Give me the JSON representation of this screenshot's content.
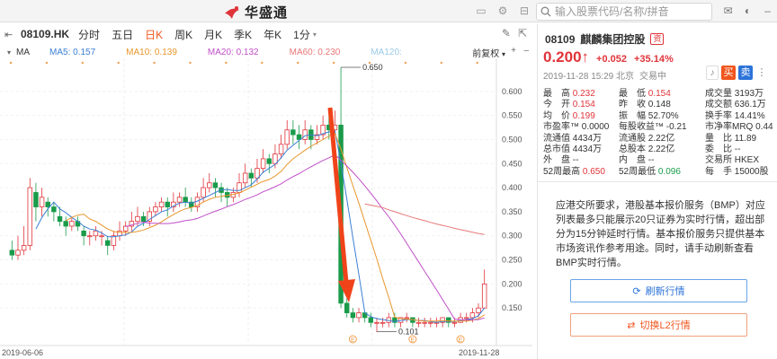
{
  "topbar": {
    "logo_text": "华盛通",
    "search_placeholder": "输入股票代码/名称/拼音",
    "icons": [
      "monitor-icon",
      "settings-icon",
      "minimize-icon",
      "maximize-icon",
      "mail-icon",
      "theme-icon",
      "window-minimize-icon",
      "close-icon"
    ]
  },
  "toolbar": {
    "stock_code": "08109.HK",
    "periods": [
      {
        "label": "分时",
        "active": false
      },
      {
        "label": "五日",
        "active": false
      },
      {
        "label": "日K",
        "active": true
      },
      {
        "label": "周K",
        "active": false
      },
      {
        "label": "月K",
        "active": false
      },
      {
        "label": "季K",
        "active": false
      },
      {
        "label": "年K",
        "active": false
      }
    ],
    "more_period": "1分",
    "more_chevron": "▾"
  },
  "ma_row": {
    "indicator": "MA",
    "items": [
      {
        "label": "MA5: 0.157",
        "color": "#3a7fd5"
      },
      {
        "label": "MA10: 0.139",
        "color": "#e8962c"
      },
      {
        "label": "MA20: 0.132",
        "color": "#c04fc8"
      },
      {
        "label": "MA60: 0.230",
        "color": "#e87878"
      },
      {
        "label": "MA120:",
        "color": "#9bc9e8"
      }
    ],
    "adjust": "前复权",
    "adjust_chevron": "▾"
  },
  "quote": {
    "code": "08109",
    "name": "麒麟集团控股",
    "badge": "资",
    "price": "0.200",
    "arrow": "↑",
    "change": "+0.052",
    "change_pct": "+35.14%",
    "time": "2019-11-28 15:29 北京",
    "status": "交易中",
    "buy": "买",
    "sell": "卖",
    "stats": [
      {
        "label": "最　高",
        "value": "0.232",
        "color": "red"
      },
      {
        "label": "最　低",
        "value": "0.154",
        "color": "red"
      },
      {
        "label": "成交量",
        "value": "3193万",
        "color": ""
      },
      {
        "label": "今　开",
        "value": "0.154",
        "color": "red"
      },
      {
        "label": "昨　收",
        "value": "0.148",
        "color": ""
      },
      {
        "label": "成交额",
        "value": "636.1万",
        "color": ""
      },
      {
        "label": "均　价",
        "value": "0.199",
        "color": "red"
      },
      {
        "label": "振　幅",
        "value": "52.70%",
        "color": ""
      },
      {
        "label": "换手率",
        "value": "14.41%",
        "color": ""
      },
      {
        "label": "市盈率™",
        "value": "0.0000",
        "color": ""
      },
      {
        "label": "每股收益™",
        "value": "-0.21",
        "color": ""
      },
      {
        "label": "市净率MRQ",
        "value": "0.44",
        "color": ""
      },
      {
        "label": "流通值",
        "value": "4434万",
        "color": ""
      },
      {
        "label": "流通股",
        "value": "2.22亿",
        "color": ""
      },
      {
        "label": "量　比",
        "value": "11.89",
        "color": ""
      },
      {
        "label": "总市值",
        "value": "4434万",
        "color": ""
      },
      {
        "label": "总股本",
        "value": "2.22亿",
        "color": ""
      },
      {
        "label": "委　比",
        "value": "--",
        "color": ""
      },
      {
        "label": "外　盘",
        "value": "--",
        "color": ""
      },
      {
        "label": "内　盘",
        "value": "--",
        "color": ""
      },
      {
        "label": "交易所",
        "value": "HKEX",
        "color": ""
      },
      {
        "label": "52周最高",
        "value": "0.650",
        "color": "red"
      },
      {
        "label": "52周最低",
        "value": "0.096",
        "color": "green"
      },
      {
        "label": "每　手",
        "value": "15000股",
        "color": ""
      }
    ]
  },
  "notice": {
    "text": "应港交所要求，港股基本报价服务（BMP）对应列表最多只能展示20只证券为实时行情，超出部分为15分钟延时行情。基本报价服务只提供基本市场资讯作参考用途。同时，请手动刷新查看BMP实时行情。",
    "refresh_button": "刷新行情",
    "l2_button": "切换L2行情"
  },
  "chart_data": {
    "type": "candlestick",
    "y_ticks": [
      "0.600",
      "0.550",
      "0.500",
      "0.450",
      "0.400",
      "0.350",
      "0.300",
      "0.250",
      "0.200",
      "0.150"
    ],
    "ylim": [
      0.1,
      0.65
    ],
    "x_start_label": "2019-06-06",
    "x_end_label": "2019-11-28",
    "annotations": {
      "high": "0.650",
      "low": "0.101"
    },
    "event_markers": "E",
    "candles": [
      [
        0.27,
        0.26,
        0.29,
        0.25
      ],
      [
        0.26,
        0.27,
        0.3,
        0.25
      ],
      [
        0.27,
        0.28,
        0.32,
        0.26
      ],
      [
        0.28,
        0.4,
        0.42,
        0.27
      ],
      [
        0.39,
        0.36,
        0.41,
        0.33
      ],
      [
        0.36,
        0.38,
        0.4,
        0.34
      ],
      [
        0.37,
        0.36,
        0.38,
        0.34
      ],
      [
        0.36,
        0.35,
        0.37,
        0.33
      ],
      [
        0.34,
        0.33,
        0.36,
        0.32
      ],
      [
        0.33,
        0.32,
        0.34,
        0.3
      ],
      [
        0.32,
        0.33,
        0.34,
        0.31
      ],
      [
        0.33,
        0.32,
        0.34,
        0.31
      ],
      [
        0.31,
        0.3,
        0.32,
        0.28
      ],
      [
        0.3,
        0.3,
        0.31,
        0.28
      ],
      [
        0.3,
        0.31,
        0.32,
        0.29
      ],
      [
        0.3,
        0.3,
        0.31,
        0.28
      ],
      [
        0.29,
        0.28,
        0.3,
        0.26
      ],
      [
        0.28,
        0.3,
        0.31,
        0.27
      ],
      [
        0.3,
        0.31,
        0.33,
        0.29
      ],
      [
        0.31,
        0.32,
        0.33,
        0.3
      ],
      [
        0.32,
        0.33,
        0.35,
        0.31
      ],
      [
        0.33,
        0.34,
        0.36,
        0.32
      ],
      [
        0.34,
        0.33,
        0.35,
        0.32
      ],
      [
        0.33,
        0.35,
        0.36,
        0.32
      ],
      [
        0.35,
        0.36,
        0.37,
        0.34
      ],
      [
        0.36,
        0.37,
        0.38,
        0.35
      ],
      [
        0.37,
        0.36,
        0.38,
        0.34
      ],
      [
        0.36,
        0.37,
        0.39,
        0.35
      ],
      [
        0.37,
        0.38,
        0.39,
        0.36
      ],
      [
        0.38,
        0.37,
        0.4,
        0.36
      ],
      [
        0.37,
        0.36,
        0.38,
        0.35
      ],
      [
        0.36,
        0.38,
        0.39,
        0.35
      ],
      [
        0.38,
        0.4,
        0.42,
        0.37
      ],
      [
        0.4,
        0.41,
        0.43,
        0.39
      ],
      [
        0.41,
        0.4,
        0.42,
        0.38
      ],
      [
        0.4,
        0.39,
        0.41,
        0.37
      ],
      [
        0.39,
        0.38,
        0.4,
        0.36
      ],
      [
        0.38,
        0.39,
        0.4,
        0.37
      ],
      [
        0.39,
        0.41,
        0.43,
        0.38
      ],
      [
        0.41,
        0.43,
        0.45,
        0.4
      ],
      [
        0.43,
        0.42,
        0.44,
        0.4
      ],
      [
        0.42,
        0.44,
        0.46,
        0.41
      ],
      [
        0.44,
        0.46,
        0.48,
        0.43
      ],
      [
        0.46,
        0.45,
        0.47,
        0.43
      ],
      [
        0.45,
        0.47,
        0.49,
        0.44
      ],
      [
        0.47,
        0.49,
        0.51,
        0.46
      ],
      [
        0.49,
        0.52,
        0.54,
        0.48
      ],
      [
        0.52,
        0.51,
        0.54,
        0.49
      ],
      [
        0.51,
        0.5,
        0.53,
        0.48
      ],
      [
        0.5,
        0.52,
        0.54,
        0.49
      ],
      [
        0.52,
        0.5,
        0.53,
        0.48
      ],
      [
        0.5,
        0.51,
        0.53,
        0.49
      ],
      [
        0.51,
        0.53,
        0.55,
        0.5
      ],
      [
        0.53,
        0.52,
        0.55,
        0.5
      ],
      [
        0.52,
        0.53,
        0.56,
        0.51
      ],
      [
        0.53,
        0.16,
        0.65,
        0.15
      ],
      [
        0.16,
        0.14,
        0.17,
        0.13
      ],
      [
        0.14,
        0.13,
        0.15,
        0.12
      ],
      [
        0.13,
        0.14,
        0.15,
        0.12
      ],
      [
        0.14,
        0.13,
        0.14,
        0.12
      ],
      [
        0.13,
        0.12,
        0.14,
        0.11
      ],
      [
        0.12,
        0.12,
        0.13,
        0.1
      ],
      [
        0.12,
        0.12,
        0.13,
        0.11
      ],
      [
        0.12,
        0.13,
        0.14,
        0.11
      ],
      [
        0.13,
        0.12,
        0.14,
        0.11
      ],
      [
        0.12,
        0.13,
        0.13,
        0.11
      ],
      [
        0.13,
        0.13,
        0.14,
        0.12
      ],
      [
        0.13,
        0.12,
        0.13,
        0.11
      ],
      [
        0.12,
        0.12,
        0.13,
        0.11
      ],
      [
        0.12,
        0.12,
        0.13,
        0.11
      ],
      [
        0.12,
        0.12,
        0.13,
        0.11
      ],
      [
        0.12,
        0.12,
        0.13,
        0.11
      ],
      [
        0.12,
        0.13,
        0.13,
        0.11
      ],
      [
        0.13,
        0.12,
        0.13,
        0.11
      ],
      [
        0.12,
        0.12,
        0.13,
        0.11
      ],
      [
        0.12,
        0.13,
        0.14,
        0.12
      ],
      [
        0.13,
        0.13,
        0.14,
        0.12
      ],
      [
        0.13,
        0.14,
        0.15,
        0.12
      ],
      [
        0.14,
        0.15,
        0.16,
        0.13
      ],
      [
        0.15,
        0.2,
        0.23,
        0.15
      ]
    ],
    "colors": {
      "up": "#e0343a",
      "down": "#1a9b4a",
      "arrow": "#f0431a"
    }
  }
}
